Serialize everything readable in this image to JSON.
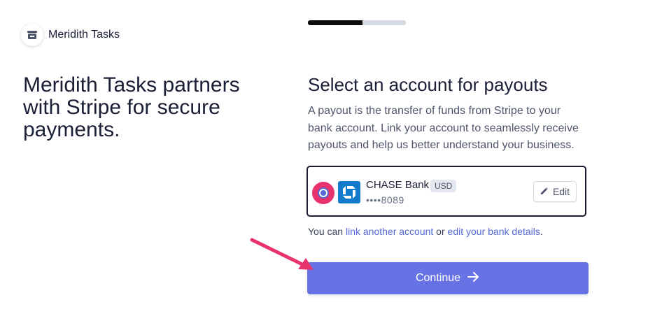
{
  "brand": {
    "name": "Meridith Tasks",
    "logo_icon": "store-icon"
  },
  "headline": "Meridith Tasks partners with Stripe for secure payments.",
  "progress": {
    "current_step": 1,
    "total_steps": 2,
    "fraction_complete": 0.56
  },
  "page": {
    "title": "Select an account for payouts",
    "description": "A payout is the transfer of funds from Stripe to your bank account. Link your account to seamlessly receive payouts and help us better understand your business."
  },
  "account": {
    "bank_name": "CHASE Bank",
    "currency": "USD",
    "masked_number": "••••8089",
    "edit_label": "Edit",
    "selected": true,
    "bank_icon": "chase-logo-icon"
  },
  "help": {
    "prefix": "You can ",
    "link_account": "link another account",
    "middle": " or ",
    "edit_details": "edit your bank details",
    "suffix": "."
  },
  "continue_button": {
    "label": "Continue"
  },
  "colors": {
    "accent": "#6772e5",
    "link": "#5469d4",
    "highlight": "#e8336c",
    "chase_blue": "#117aca",
    "text": "#1a1f36"
  }
}
